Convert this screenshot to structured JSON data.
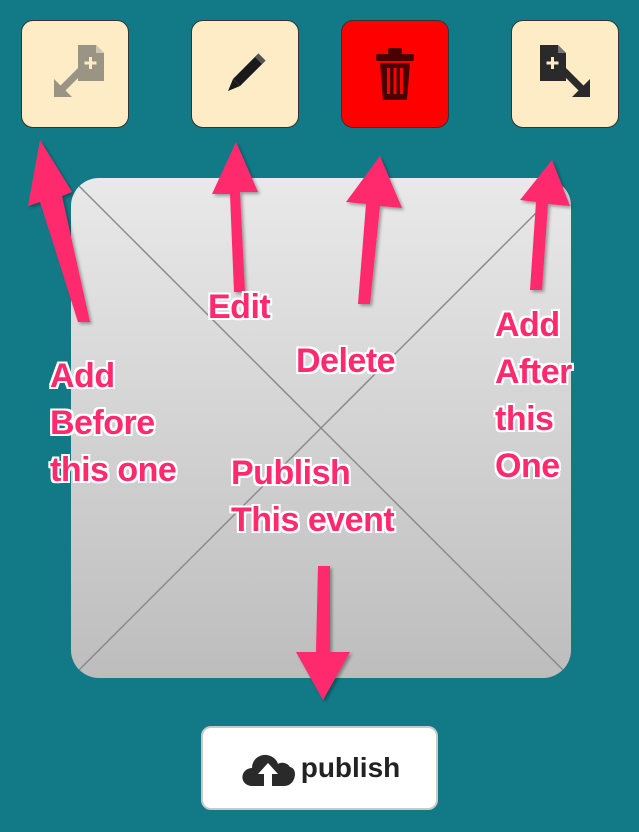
{
  "toolbar": {
    "add_before_icon": "add-file-before-icon",
    "edit_icon": "pencil-icon",
    "delete_icon": "trash-icon",
    "add_after_icon": "add-file-after-icon"
  },
  "annotations": {
    "edit": "Edit",
    "delete": "Delete",
    "add_before": "Add\nBefore\nthis one",
    "add_after": "Add\nAfter\nthis\nOne",
    "publish": "Publish\nThis event"
  },
  "publish_button": {
    "label": "publish",
    "icon": "cloud-upload-icon"
  },
  "colors": {
    "background": "#127a87",
    "tool_button": "#fdecc6",
    "delete_button": "#ff0000",
    "annotation_text": "#ff2a6e",
    "arrow": "#ff2a6e"
  }
}
